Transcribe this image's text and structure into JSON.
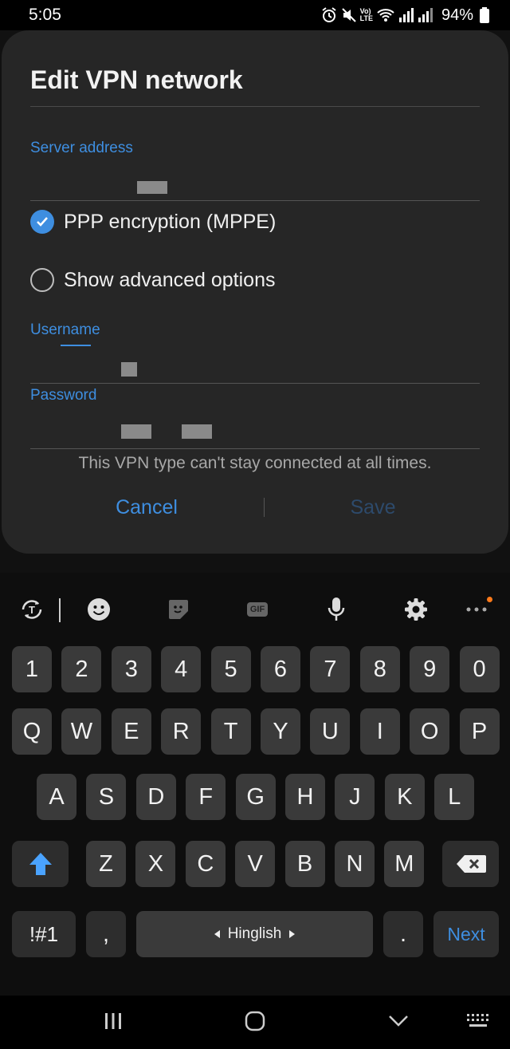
{
  "status": {
    "time": "5:05",
    "lte_label_top": "Vo)",
    "lte_label_bottom": "LTE",
    "battery": "94%"
  },
  "dialog": {
    "title": "Edit VPN network",
    "server_address_label": "Server address",
    "ppp_encryption_label": "PPP encryption (MPPE)",
    "ppp_encryption_checked": true,
    "advanced_options_label": "Show advanced options",
    "advanced_options_checked": false,
    "username_label": "Username",
    "password_label": "Password",
    "note": "This VPN type can't stay connected at all times.",
    "cancel_label": "Cancel",
    "save_label": "Save"
  },
  "keyboard": {
    "toolbar": {
      "gif_label": "GIF"
    },
    "number_row": [
      "1",
      "2",
      "3",
      "4",
      "5",
      "6",
      "7",
      "8",
      "9",
      "0"
    ],
    "row1": [
      "Q",
      "W",
      "E",
      "R",
      "T",
      "Y",
      "U",
      "I",
      "O",
      "P"
    ],
    "row2": [
      "A",
      "S",
      "D",
      "F",
      "G",
      "H",
      "J",
      "K",
      "L"
    ],
    "row3": [
      "Z",
      "X",
      "C",
      "V",
      "B",
      "N",
      "M"
    ],
    "symbols_label": "!#1",
    "comma_label": ",",
    "space_label": "Hinglish",
    "period_label": ".",
    "next_label": "Next"
  },
  "colors": {
    "accent": "#3e8ee0",
    "dialog_bg": "#262626",
    "key_bg": "#3a3a3a"
  }
}
